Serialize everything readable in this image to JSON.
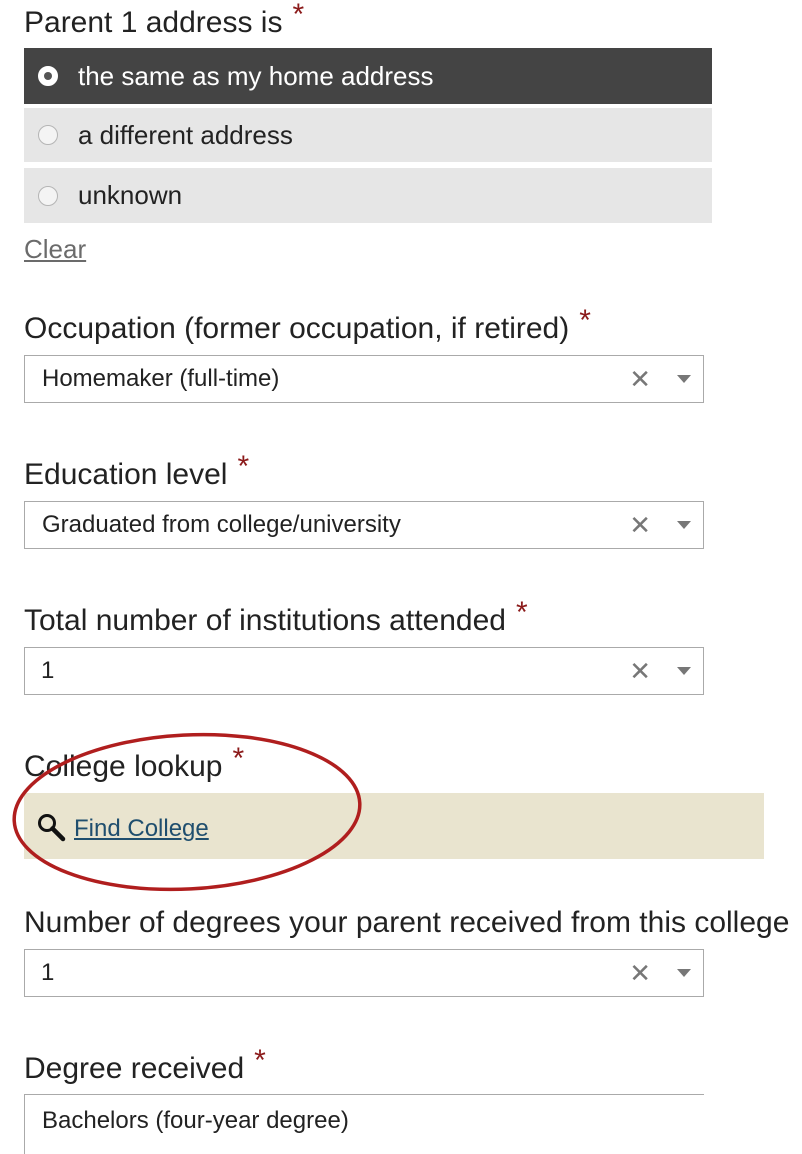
{
  "address": {
    "label": "Parent 1 address is",
    "required_mark": "*",
    "options": [
      {
        "label": "the same as my home address",
        "selected": true
      },
      {
        "label": "a different address",
        "selected": false
      },
      {
        "label": "unknown",
        "selected": false
      }
    ],
    "clear_label": "Clear"
  },
  "occupation": {
    "label": "Occupation (former occupation, if retired)",
    "required_mark": "*",
    "value": "Homemaker (full-time)",
    "clear_symbol": "✕"
  },
  "education": {
    "label": "Education level",
    "required_mark": "*",
    "value": "Graduated from college/university",
    "clear_symbol": "✕"
  },
  "institutions": {
    "label": "Total number of institutions attended",
    "required_mark": "*",
    "value": "1",
    "clear_symbol": "✕"
  },
  "college_lookup": {
    "label": "College lookup",
    "required_mark": "*",
    "link_label": "Find College",
    "icon": "search-icon",
    "highlight_color": "#b01e1e"
  },
  "degrees_count": {
    "label": "Number of degrees your parent received from this college",
    "value": "1",
    "clear_symbol": "✕"
  },
  "degree_received": {
    "label": "Degree received",
    "required_mark": "*",
    "value": "Bachelors (four-year degree)"
  },
  "colors": {
    "required": "#8b1a1a",
    "selected_row": "#444444",
    "unselected_row": "#e6e6e6",
    "lookup_background": "#e9e4cf",
    "link": "#1f4e6e"
  }
}
